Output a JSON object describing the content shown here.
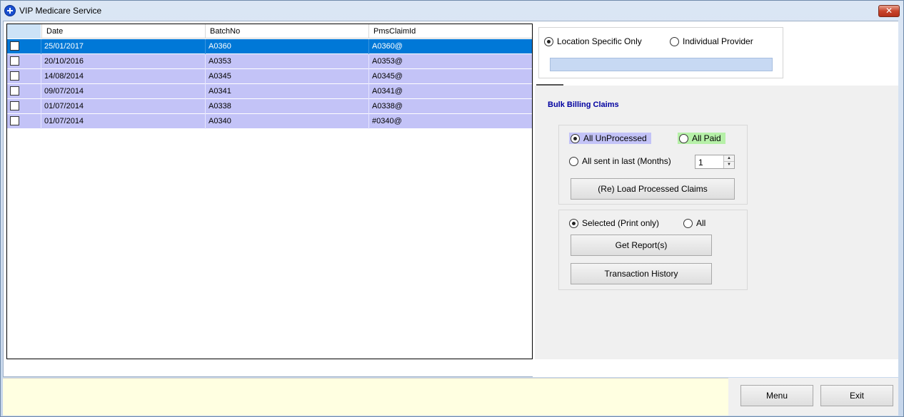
{
  "window": {
    "title": "VIP Medicare Service",
    "close_label": "✕"
  },
  "grid": {
    "columns": [
      "Date",
      "BatchNo",
      "PmsClaimId"
    ],
    "rows": [
      {
        "date": "25/01/2017",
        "batch": "A0360",
        "claim": "A0360@",
        "selected": true
      },
      {
        "date": "20/10/2016",
        "batch": "A0353",
        "claim": "A0353@",
        "selected": false
      },
      {
        "date": "14/08/2014",
        "batch": "A0345",
        "claim": "A0345@",
        "selected": false
      },
      {
        "date": "09/07/2014",
        "batch": "A0341",
        "claim": "A0341@",
        "selected": false
      },
      {
        "date": "01/07/2014",
        "batch": "A0338",
        "claim": "A0338@",
        "selected": false
      },
      {
        "date": "01/07/2014",
        "batch": "A0340",
        "claim": "#0340@",
        "selected": false
      }
    ]
  },
  "location": {
    "location_specific": "Location Specific Only",
    "individual_provider": "Individual Provider",
    "selected": "location_specific"
  },
  "bulk": {
    "title": "Bulk Billing Claims",
    "all_unprocessed": "All UnProcessed",
    "all_paid": "All Paid",
    "all_sent_last": "All sent in last (Months)",
    "months_value": "1",
    "reload_button": "(Re) Load Processed Claims"
  },
  "report": {
    "selected_print": "Selected (Print only)",
    "all": "All",
    "get_reports_button": "Get Report(s)",
    "transaction_history_button": "Transaction History"
  },
  "footer": {
    "menu_button": "Menu",
    "exit_button": "Exit"
  },
  "colors": {
    "row_bg": "#c3c3f7",
    "row_selected": "#0078d7",
    "all_paid_bg": "#b6f0a8",
    "status_bar": "#ffffe1"
  }
}
